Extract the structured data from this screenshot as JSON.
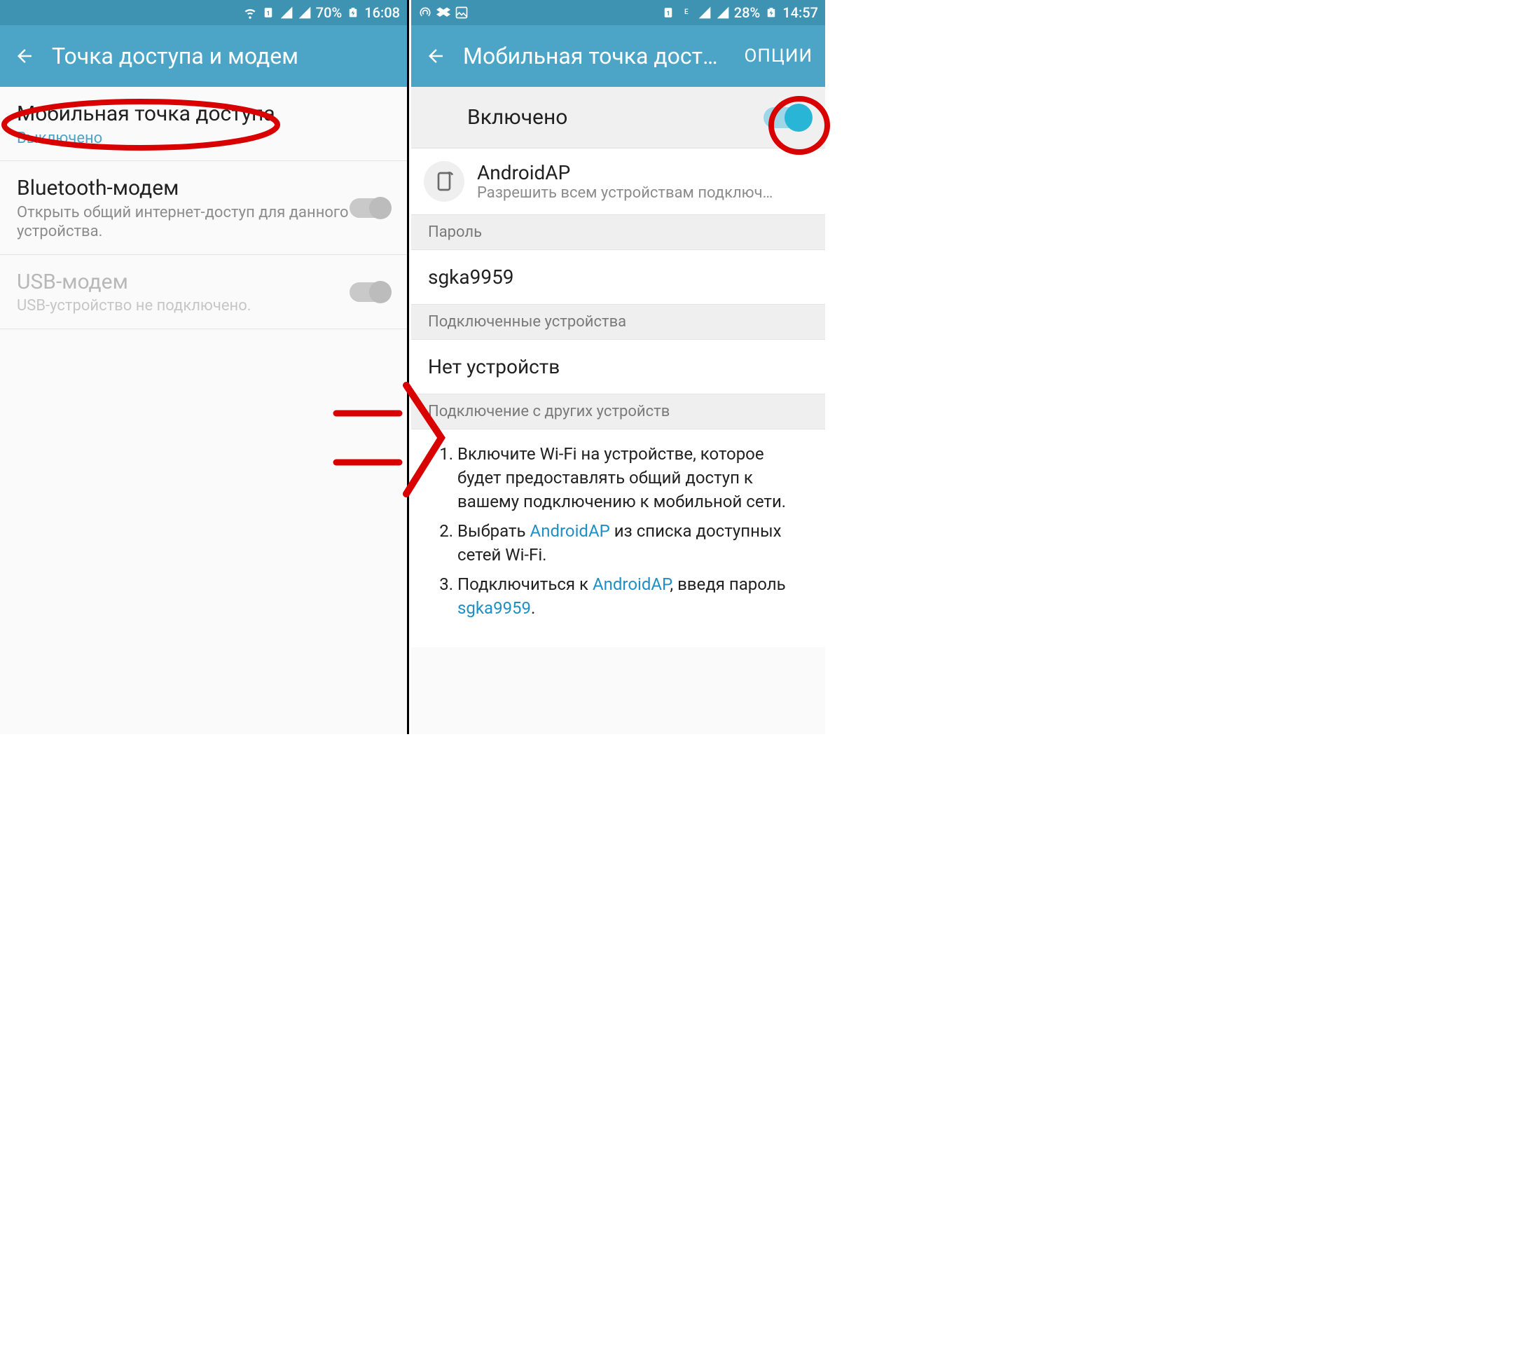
{
  "left": {
    "status": {
      "battery": "70%",
      "time": "16:08"
    },
    "appbar_title": "Точка доступа и модем",
    "rows": {
      "hotspot": {
        "title": "Мобильная точка доступа",
        "state": "Выключено"
      },
      "bt": {
        "title": "Bluetooth-модем",
        "sub": "Открыть общий интернет-доступ для данного устройства."
      },
      "usb": {
        "title": "USB-модем",
        "sub": "USB-устройство не подключено."
      }
    }
  },
  "right": {
    "status": {
      "battery": "28%",
      "time": "14:57"
    },
    "appbar_title": "Мобильная точка дост…",
    "options_label": "ОПЦИИ",
    "master_label": "Включено",
    "ap": {
      "name": "AndroidAP",
      "sub": "Разрешить всем устройствам подключ…"
    },
    "sections": {
      "password_head": "Пароль",
      "password_value": "sgka9959",
      "connected_head": "Подключенные устройства",
      "connected_value": "Нет устройств",
      "howto_head": "Подключение с других устройств"
    },
    "steps": {
      "s1": "Включите Wi-Fi на устройстве, которое будет предоставлять общий доступ к вашему подключению к мобильной сети.",
      "s2a": "Выбрать ",
      "s2b": " из списка доступных сетей Wi-Fi.",
      "s3a": "Подключиться к ",
      "s3b": ", введя пароль ",
      "s3c": "."
    }
  }
}
